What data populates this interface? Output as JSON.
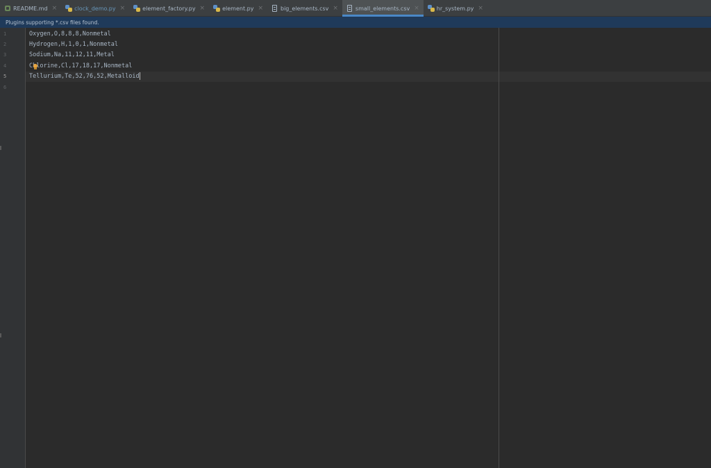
{
  "tabs": [
    {
      "label": "README.md",
      "icon": "markdown-file-icon",
      "active": false,
      "modified": false
    },
    {
      "label": "clock_demo.py",
      "icon": "python-file-icon",
      "active": false,
      "modified": true
    },
    {
      "label": "element_factory.py",
      "icon": "python-file-icon",
      "active": false,
      "modified": false
    },
    {
      "label": "element.py",
      "icon": "python-file-icon",
      "active": false,
      "modified": false
    },
    {
      "label": "big_elements.csv",
      "icon": "csv-file-icon",
      "active": false,
      "modified": false
    },
    {
      "label": "small_elements.csv",
      "icon": "csv-file-icon",
      "active": true,
      "modified": false
    },
    {
      "label": "hr_system.py",
      "icon": "python-file-icon",
      "active": false,
      "modified": false
    }
  ],
  "close_glyph": "×",
  "banner": {
    "text": "Plugins supporting *.csv files found."
  },
  "editor": {
    "line_numbers": [
      "1",
      "2",
      "3",
      "4",
      "5",
      "6"
    ],
    "current_line": 5,
    "lines": [
      "Oxygen,O,8,8,8,Nonmetal",
      "Hydrogen,H,1,0,1,Nonmetal",
      "Sodium,Na,11,12,11,Metal",
      "Chlorine,Cl,17,18,17,Nonmetal",
      "Tellurium,Te,52,76,52,Metalloid",
      ""
    ]
  },
  "colors": {
    "background": "#2b2b2b",
    "tab_bar": "#3c3f41",
    "active_tab_underline": "#4a88c7",
    "banner": "#1f3a5a",
    "text": "#a9b7c6"
  }
}
